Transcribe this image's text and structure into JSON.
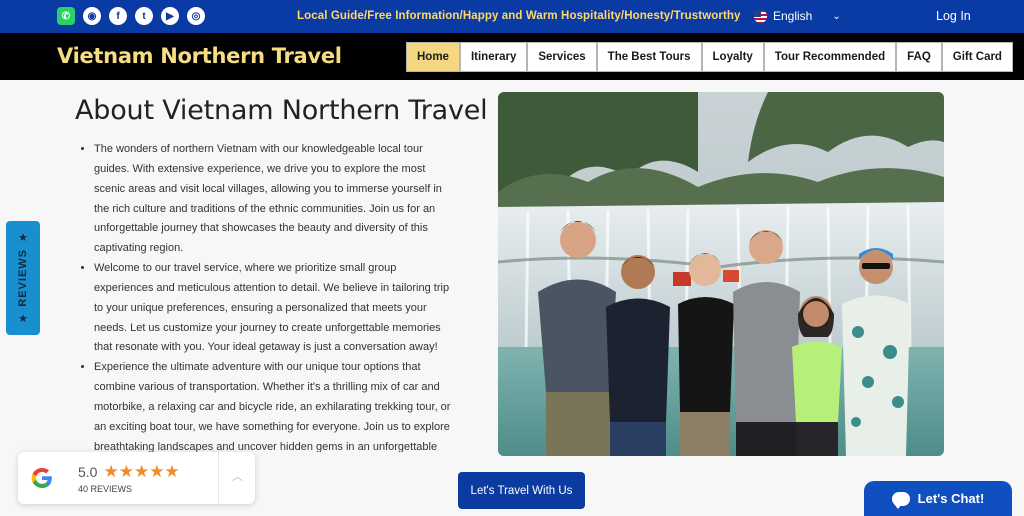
{
  "topbar": {
    "social_icons": [
      "whatsapp-icon",
      "tripadvisor-icon",
      "facebook-icon",
      "twitter-icon",
      "youtube-icon",
      "instagram-icon"
    ],
    "tagline": "Local Guide/Free Information/Happy and Warm Hospitality/Honesty/Trustworthy",
    "language": "English",
    "login_label": "Log In"
  },
  "header": {
    "brand": "Vietnam Northern Travel",
    "nav": [
      {
        "label": "Home",
        "active": true
      },
      {
        "label": "Itinerary"
      },
      {
        "label": "Services"
      },
      {
        "label": "The Best Tours"
      },
      {
        "label": "Loyalty"
      },
      {
        "label": "Tour Recommended"
      },
      {
        "label": "FAQ"
      },
      {
        "label": "Gift Card"
      }
    ]
  },
  "main": {
    "title": "About Vietnam Northern Travel",
    "paragraphs": [
      "The wonders of northern Vietnam with our knowledgeable local tour guides. With extensive experience, we drive you to explore the most scenic areas and visit local villages, allowing you to immerse yourself in the rich culture and traditions of the ethnic communities. Join us for an unforgettable journey that showcases the beauty and diversity of this captivating region.",
      "Welcome to our travel service, where we prioritize small group experiences and meticulous attention to detail. We believe in tailoring trip to your unique preferences, ensuring a personalized that meets your needs. Let us customize your journey to create unforgettable memories that resonate with you. Your ideal getaway is just a conversation away!",
      "Experience the ultimate adventure with our unique tour options that combine various of transportation. Whether it's a thrilling mix of car and motorbike, a relaxing car and bicycle ride, an exhilarating trekking tour, or an exciting boat tour, we have something for everyone. Join us to explore breathtaking landscapes and uncover hidden gems in an unforgettable"
    ],
    "cta_label": "Let's Travel With Us"
  },
  "reviews_tab": {
    "label": "REVIEWS"
  },
  "google_widget": {
    "score": "5.0",
    "rating": 5,
    "count_label": "40 REVIEWS"
  },
  "chat": {
    "label": "Let's Chat!"
  },
  "colors": {
    "topbar": "#0a3aa3",
    "brand": "#f6dd82",
    "active_nav": "#f4d780",
    "cta": "#0b3aa0",
    "stars": "#f28c28"
  }
}
